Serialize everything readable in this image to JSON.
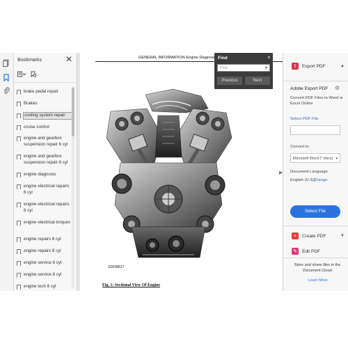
{
  "bookmarks": {
    "title": "Bookmarks",
    "items": [
      {
        "label": "brake pedal repair",
        "selected": false
      },
      {
        "label": "Brakes",
        "selected": false
      },
      {
        "label": "cooling system repair",
        "selected": true
      },
      {
        "label": "cruise control",
        "selected": false
      },
      {
        "label": "engine and gearbox suspension repair 6 cyl",
        "selected": false
      },
      {
        "label": "engine and gearbox suspension repair 8 cyl",
        "selected": false
      },
      {
        "label": "engine diagnosis",
        "selected": false
      },
      {
        "label": "engine electrical repairs 6 cyl",
        "selected": false
      },
      {
        "label": "engine electrical repairs 8 cyl",
        "selected": false
      },
      {
        "label": "engine electrical torques",
        "selected": false
      },
      {
        "label": "engine repairs 6 cyl",
        "selected": false
      },
      {
        "label": "engine repairs 8 cyl",
        "selected": false
      },
      {
        "label": "engine service 6 cyl",
        "selected": false
      },
      {
        "label": "engine service 8 cyl",
        "selected": false
      },
      {
        "label": "engine tech 6 cyl",
        "selected": false
      }
    ]
  },
  "document": {
    "header": "GENERAL INFORMATION Engine Diagnosis - Over",
    "figure_code": "G0038817",
    "caption": "Fig. 1: Sectional View Of Engine"
  },
  "find": {
    "title": "Find",
    "close": "×",
    "placeholder": "Find",
    "previous": "Previous",
    "next": "Next"
  },
  "right_panel": {
    "export_pdf": "Export PDF",
    "section_title": "Adobe Export PDF",
    "description": "Convert PDF Files to Word or Excel Online",
    "select_pdf": "Select PDF File",
    "convert_to_label": "Convert to",
    "convert_to_value": "Microsoft Word (*.docx)",
    "doc_lang_label": "Document Language",
    "doc_lang_value": "English (U.S.)",
    "change": "Change",
    "select_file": "Select File",
    "create_pdf": "Create PDF",
    "edit_pdf": "Edit PDF",
    "cloud_text": "Store and share files in the Document Cloud",
    "learn_more": "Learn More"
  },
  "colors": {
    "accent": "#2b74e0",
    "export_icon": "#d9334a",
    "create_icon": "#e0433b",
    "edit_icon": "#d83a7a",
    "find_bg": "#3b3b3b"
  }
}
